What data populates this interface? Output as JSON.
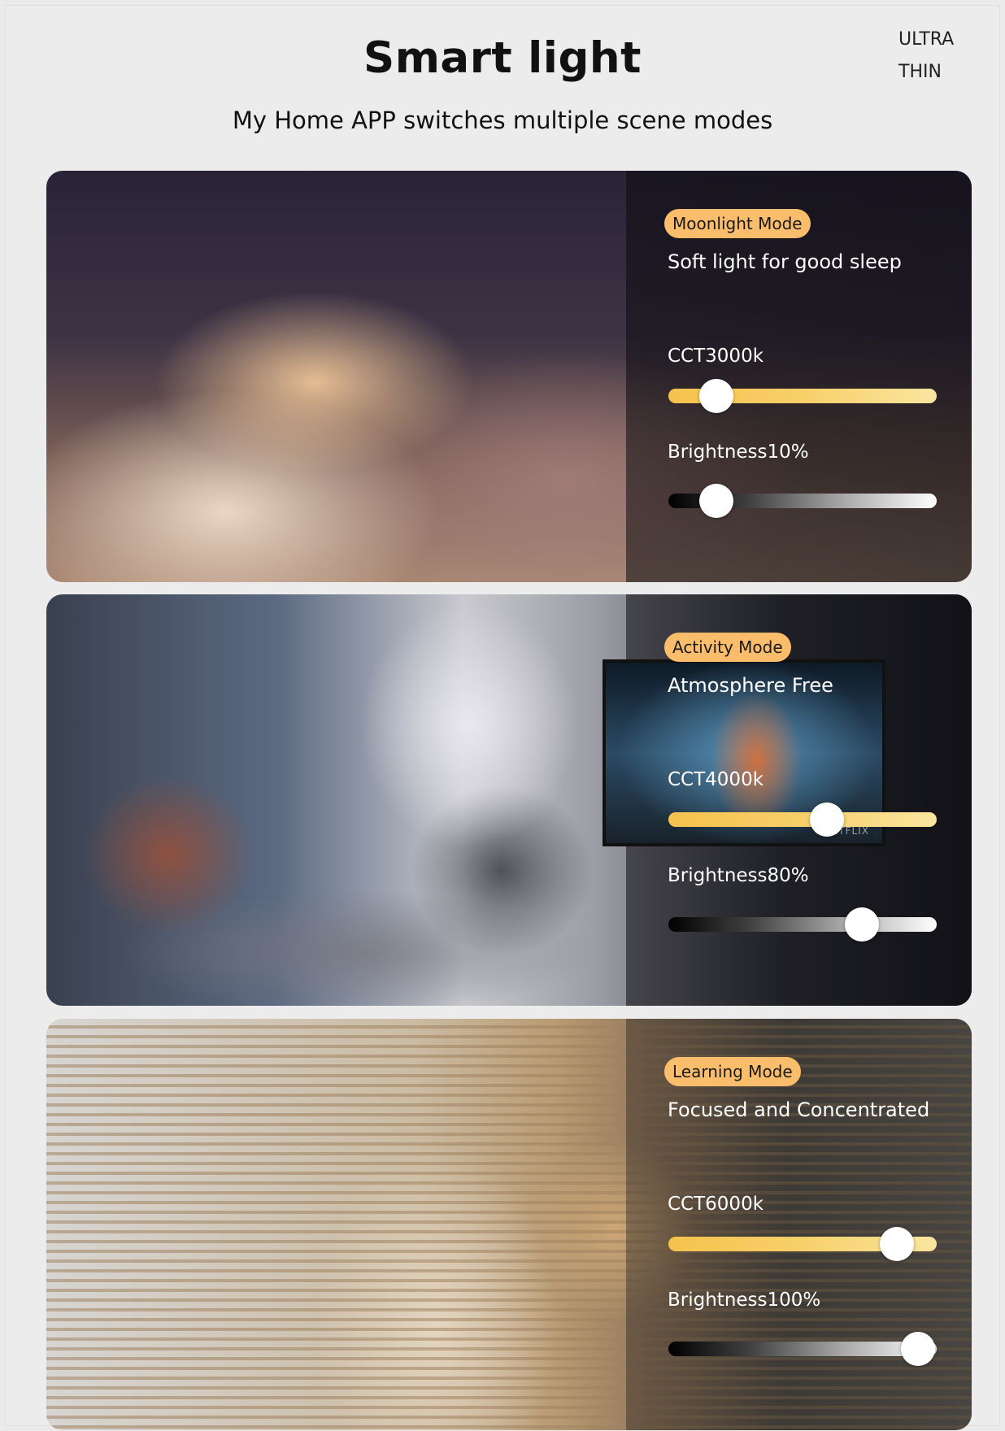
{
  "header": {
    "title": "Smart light",
    "badge_line1": "ULTRA",
    "badge_line2": "THIN",
    "subtitle": "My Home APP switches multiple scene modes"
  },
  "colors": {
    "mode_pill": "#f9bd6c",
    "cct_track_start": "#f6c24c",
    "cct_track_end": "#f9e5a0",
    "text_on_dark": "#ffffff"
  },
  "modes": [
    {
      "mode_label": "Moonlight Mode",
      "description": "Soft light for good sleep",
      "cct_label": "CCT3000k",
      "cct_level": 0.18,
      "brightness_label": "Brightness10%",
      "brightness_level": 0.18
    },
    {
      "mode_label": "Activity Mode",
      "description": "Atmosphere Free",
      "cct_label": "CCT4000k",
      "cct_level": 0.59,
      "brightness_label": "Brightness80%",
      "brightness_level": 0.72,
      "tv_brand": "NETFLIX"
    },
    {
      "mode_label": "Learning Mode",
      "description": "Focused and Concentrated",
      "cct_label": "CCT6000k",
      "cct_level": 0.85,
      "brightness_label": "Brightness100%",
      "brightness_level": 0.93
    }
  ]
}
